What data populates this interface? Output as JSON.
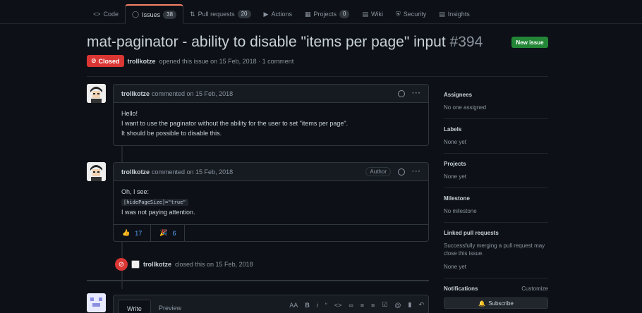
{
  "nav": {
    "tabs": [
      {
        "icon": "code-icon",
        "label": "Code",
        "count": ""
      },
      {
        "icon": "issue-icon",
        "label": "Issues",
        "count": "38"
      },
      {
        "icon": "pull-request-icon",
        "label": "Pull requests",
        "count": "20"
      },
      {
        "icon": "play-icon",
        "label": "Actions",
        "count": ""
      },
      {
        "icon": "project-icon",
        "label": "Projects",
        "count": "0"
      },
      {
        "icon": "book-icon",
        "label": "Wiki",
        "count": ""
      },
      {
        "icon": "shield-icon",
        "label": "Security",
        "count": ""
      },
      {
        "icon": "graph-icon",
        "label": "Insights",
        "count": ""
      }
    ]
  },
  "issue": {
    "title": "mat-paginator - ability to disable \"items per page\" input",
    "number": "#394",
    "new_issue_label": "New issue",
    "status": "Closed",
    "author": "trollkotze",
    "opened_text": "opened this issue on 15 Feb, 2018 · 1 comment"
  },
  "comments": [
    {
      "author": "trollkotze",
      "meta": "commented on 15 Feb, 2018",
      "tag": "",
      "lines": [
        "Hello!",
        "I want to use the paginator without the ability for the user to set \"items per page\".",
        "It should be possible to disable this."
      ]
    },
    {
      "author": "trollkotze",
      "meta": "commented on 15 Feb, 2018",
      "tag": "Author",
      "line1": "Oh, I see:",
      "code": "[hidePageSize]=\"true\"",
      "line3": "I was not paying attention.",
      "reactions": [
        {
          "icon": "thumbs-up-icon",
          "count": "17"
        },
        {
          "icon": "party-icon",
          "count": "6"
        }
      ]
    }
  ],
  "event": {
    "actor": "trollkotze",
    "text": "closed this on 15 Feb, 2018"
  },
  "editor": {
    "write_label": "Write",
    "preview_label": "Preview",
    "toolbar": [
      "AA",
      "B",
      "i",
      "“",
      "<>",
      "∞",
      "≡",
      "≡",
      "☑",
      "@",
      "▮",
      "↶"
    ]
  },
  "sidebar": {
    "assignees_title": "Assignees",
    "assignees_value": "No one assigned",
    "labels_title": "Labels",
    "labels_value": "None yet",
    "projects_title": "Projects",
    "projects_value": "None yet",
    "milestone_title": "Milestone",
    "milestone_value": "No milestone",
    "linked_title": "Linked pull requests",
    "linked_desc": "Successfully merging a pull request may close this issue.",
    "linked_value": "None yet",
    "notifications_title": "Notifications",
    "customize_label": "Customize",
    "subscribe_label": "Subscribe"
  }
}
